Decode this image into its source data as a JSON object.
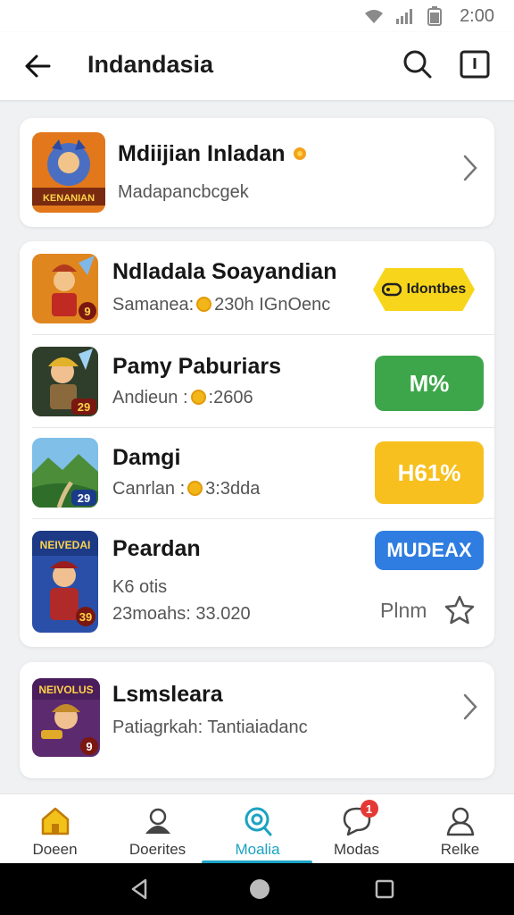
{
  "status_bar": {
    "time": "2:00",
    "icons": [
      "wifi-icon",
      "signal-icon",
      "battery-icon"
    ]
  },
  "app_bar": {
    "title": "Indandasia",
    "back_icon": "arrow-left-icon",
    "search_icon": "search-icon",
    "info_icon": "info-box-icon"
  },
  "featured": {
    "title": "Mdiijian Inladan",
    "subtitle": "Madapancbcgek",
    "thumb_text": "KENANIAN"
  },
  "list": [
    {
      "title": "Ndladala Soayandian",
      "sub_prefix": "Samanea:",
      "sub_suffix": "230h IGnOenc",
      "action": "Idontbes",
      "badge": "9"
    },
    {
      "title": "Pamy Paburiars",
      "sub_prefix": "Andieun :",
      "sub_suffix": ":2606",
      "action": "M%",
      "badge": "29"
    },
    {
      "title": "Damgi",
      "sub_prefix": "Canrlan :",
      "sub_suffix": "3:3dda",
      "action": "H61%",
      "badge": "29"
    },
    {
      "title": "Peardan",
      "sub_line1": "K6 otis",
      "sub_line2": "23moahs: 33.020",
      "action": "MUDEAX",
      "plan_label": "Plnm",
      "thumb_text": "NEIVEDAI",
      "badge": "39"
    }
  ],
  "footer_card": {
    "title": "Lsmsleara",
    "subtitle": "Patiagrkah: Tantiaiadanc",
    "thumb_text": "NEIVOLUS",
    "badge": "9"
  },
  "bottom_nav": [
    {
      "label": "Doeen",
      "icon": "home-icon",
      "active": false
    },
    {
      "label": "Doerites",
      "icon": "user-card-icon",
      "active": false
    },
    {
      "label": "Moalia",
      "icon": "search-circle-icon",
      "active": true
    },
    {
      "label": "Modas",
      "icon": "chat-icon",
      "active": false,
      "badge": "1"
    },
    {
      "label": "Relke",
      "icon": "person-icon",
      "active": false
    }
  ],
  "colors": {
    "accent": "#1ba2c2",
    "green": "#3ea64a",
    "yellow": "#f7c01e",
    "blue": "#2f7de0"
  }
}
